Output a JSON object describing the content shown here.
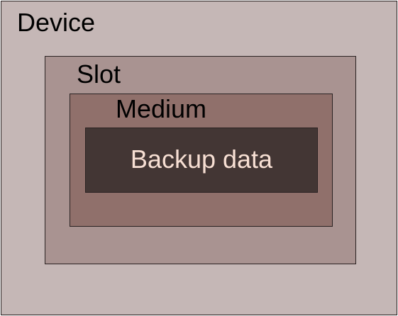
{
  "layers": {
    "device": {
      "label": "Device",
      "fill": "#c5b7b6",
      "text_color": "#000000"
    },
    "slot": {
      "label": "Slot",
      "fill": "#a99391",
      "text_color": "#000000"
    },
    "medium": {
      "label": "Medium",
      "fill": "#90706b",
      "text_color": "#000000"
    },
    "backup_data": {
      "label": "Backup data",
      "fill": "#433634",
      "text_color": "#f7dfd3"
    }
  }
}
